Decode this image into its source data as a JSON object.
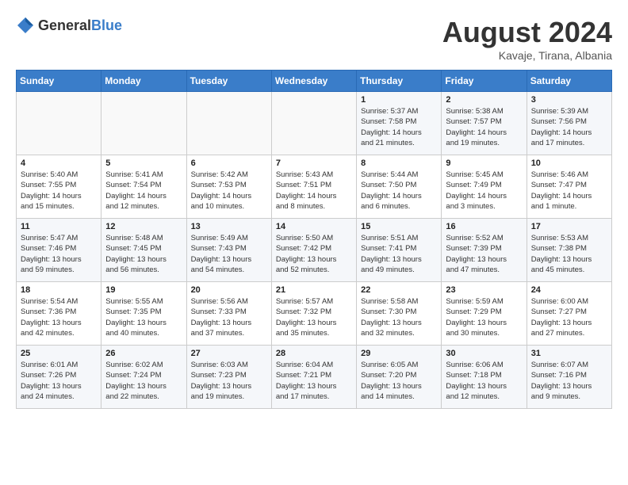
{
  "header": {
    "logo_general": "General",
    "logo_blue": "Blue",
    "title": "August 2024",
    "subtitle": "Kavaje, Tirana, Albania"
  },
  "days_of_week": [
    "Sunday",
    "Monday",
    "Tuesday",
    "Wednesday",
    "Thursday",
    "Friday",
    "Saturday"
  ],
  "weeks": [
    [
      {
        "num": "",
        "detail": ""
      },
      {
        "num": "",
        "detail": ""
      },
      {
        "num": "",
        "detail": ""
      },
      {
        "num": "",
        "detail": ""
      },
      {
        "num": "1",
        "detail": "Sunrise: 5:37 AM\nSunset: 7:58 PM\nDaylight: 14 hours\nand 21 minutes."
      },
      {
        "num": "2",
        "detail": "Sunrise: 5:38 AM\nSunset: 7:57 PM\nDaylight: 14 hours\nand 19 minutes."
      },
      {
        "num": "3",
        "detail": "Sunrise: 5:39 AM\nSunset: 7:56 PM\nDaylight: 14 hours\nand 17 minutes."
      }
    ],
    [
      {
        "num": "4",
        "detail": "Sunrise: 5:40 AM\nSunset: 7:55 PM\nDaylight: 14 hours\nand 15 minutes."
      },
      {
        "num": "5",
        "detail": "Sunrise: 5:41 AM\nSunset: 7:54 PM\nDaylight: 14 hours\nand 12 minutes."
      },
      {
        "num": "6",
        "detail": "Sunrise: 5:42 AM\nSunset: 7:53 PM\nDaylight: 14 hours\nand 10 minutes."
      },
      {
        "num": "7",
        "detail": "Sunrise: 5:43 AM\nSunset: 7:51 PM\nDaylight: 14 hours\nand 8 minutes."
      },
      {
        "num": "8",
        "detail": "Sunrise: 5:44 AM\nSunset: 7:50 PM\nDaylight: 14 hours\nand 6 minutes."
      },
      {
        "num": "9",
        "detail": "Sunrise: 5:45 AM\nSunset: 7:49 PM\nDaylight: 14 hours\nand 3 minutes."
      },
      {
        "num": "10",
        "detail": "Sunrise: 5:46 AM\nSunset: 7:47 PM\nDaylight: 14 hours\nand 1 minute."
      }
    ],
    [
      {
        "num": "11",
        "detail": "Sunrise: 5:47 AM\nSunset: 7:46 PM\nDaylight: 13 hours\nand 59 minutes."
      },
      {
        "num": "12",
        "detail": "Sunrise: 5:48 AM\nSunset: 7:45 PM\nDaylight: 13 hours\nand 56 minutes."
      },
      {
        "num": "13",
        "detail": "Sunrise: 5:49 AM\nSunset: 7:43 PM\nDaylight: 13 hours\nand 54 minutes."
      },
      {
        "num": "14",
        "detail": "Sunrise: 5:50 AM\nSunset: 7:42 PM\nDaylight: 13 hours\nand 52 minutes."
      },
      {
        "num": "15",
        "detail": "Sunrise: 5:51 AM\nSunset: 7:41 PM\nDaylight: 13 hours\nand 49 minutes."
      },
      {
        "num": "16",
        "detail": "Sunrise: 5:52 AM\nSunset: 7:39 PM\nDaylight: 13 hours\nand 47 minutes."
      },
      {
        "num": "17",
        "detail": "Sunrise: 5:53 AM\nSunset: 7:38 PM\nDaylight: 13 hours\nand 45 minutes."
      }
    ],
    [
      {
        "num": "18",
        "detail": "Sunrise: 5:54 AM\nSunset: 7:36 PM\nDaylight: 13 hours\nand 42 minutes."
      },
      {
        "num": "19",
        "detail": "Sunrise: 5:55 AM\nSunset: 7:35 PM\nDaylight: 13 hours\nand 40 minutes."
      },
      {
        "num": "20",
        "detail": "Sunrise: 5:56 AM\nSunset: 7:33 PM\nDaylight: 13 hours\nand 37 minutes."
      },
      {
        "num": "21",
        "detail": "Sunrise: 5:57 AM\nSunset: 7:32 PM\nDaylight: 13 hours\nand 35 minutes."
      },
      {
        "num": "22",
        "detail": "Sunrise: 5:58 AM\nSunset: 7:30 PM\nDaylight: 13 hours\nand 32 minutes."
      },
      {
        "num": "23",
        "detail": "Sunrise: 5:59 AM\nSunset: 7:29 PM\nDaylight: 13 hours\nand 30 minutes."
      },
      {
        "num": "24",
        "detail": "Sunrise: 6:00 AM\nSunset: 7:27 PM\nDaylight: 13 hours\nand 27 minutes."
      }
    ],
    [
      {
        "num": "25",
        "detail": "Sunrise: 6:01 AM\nSunset: 7:26 PM\nDaylight: 13 hours\nand 24 minutes."
      },
      {
        "num": "26",
        "detail": "Sunrise: 6:02 AM\nSunset: 7:24 PM\nDaylight: 13 hours\nand 22 minutes."
      },
      {
        "num": "27",
        "detail": "Sunrise: 6:03 AM\nSunset: 7:23 PM\nDaylight: 13 hours\nand 19 minutes."
      },
      {
        "num": "28",
        "detail": "Sunrise: 6:04 AM\nSunset: 7:21 PM\nDaylight: 13 hours\nand 17 minutes."
      },
      {
        "num": "29",
        "detail": "Sunrise: 6:05 AM\nSunset: 7:20 PM\nDaylight: 13 hours\nand 14 minutes."
      },
      {
        "num": "30",
        "detail": "Sunrise: 6:06 AM\nSunset: 7:18 PM\nDaylight: 13 hours\nand 12 minutes."
      },
      {
        "num": "31",
        "detail": "Sunrise: 6:07 AM\nSunset: 7:16 PM\nDaylight: 13 hours\nand 9 minutes."
      }
    ]
  ]
}
